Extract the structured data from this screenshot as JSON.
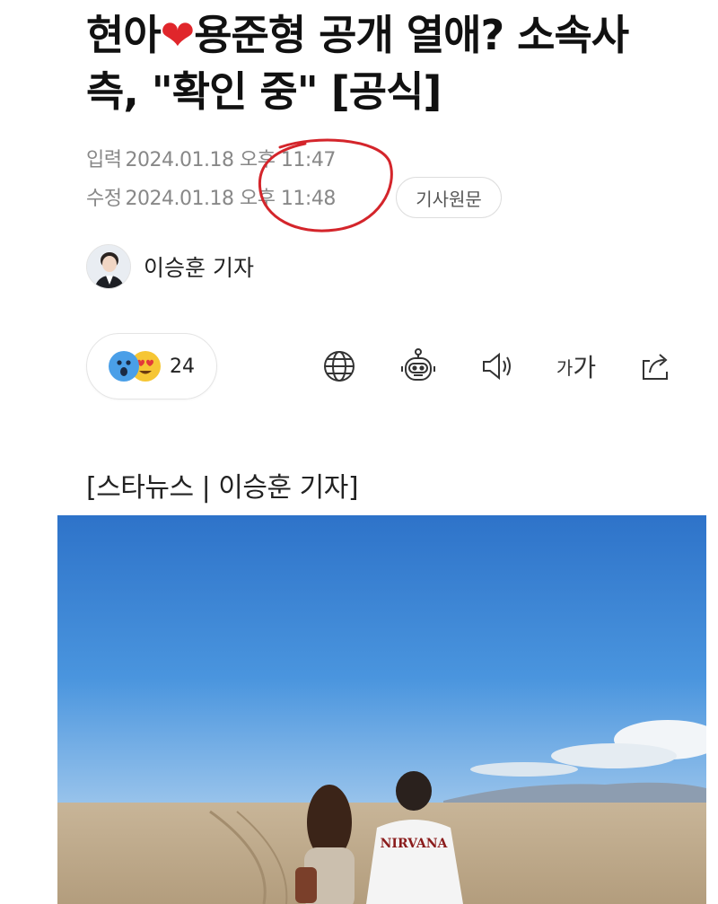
{
  "article": {
    "title_part1": "현아",
    "title_part2": "용준형 공개 열애? 소속사 측, \"확인 중\" [공식]",
    "input_label": "입력",
    "input_date": "2024.01.18",
    "input_time": "오후 11:47",
    "edit_label": "수정",
    "edit_date": "2024.01.18",
    "edit_time": "오후 11:48",
    "original_button": "기사원문",
    "author": "이승훈 기자",
    "reaction_count": "24",
    "font_size_small": "가",
    "font_size_large": "가",
    "byline": "[스타뉴스 | 이승훈 기자]",
    "shirt_text": "NIRVANA"
  },
  "icons": {
    "heart": "heart-icon",
    "globe": "globe-icon",
    "robot": "robot-summary-icon",
    "speaker": "speaker-icon",
    "share": "share-icon"
  },
  "colors": {
    "heart": "#e0262b",
    "annotation_circle": "#d4252b",
    "meta_text": "#888888"
  }
}
